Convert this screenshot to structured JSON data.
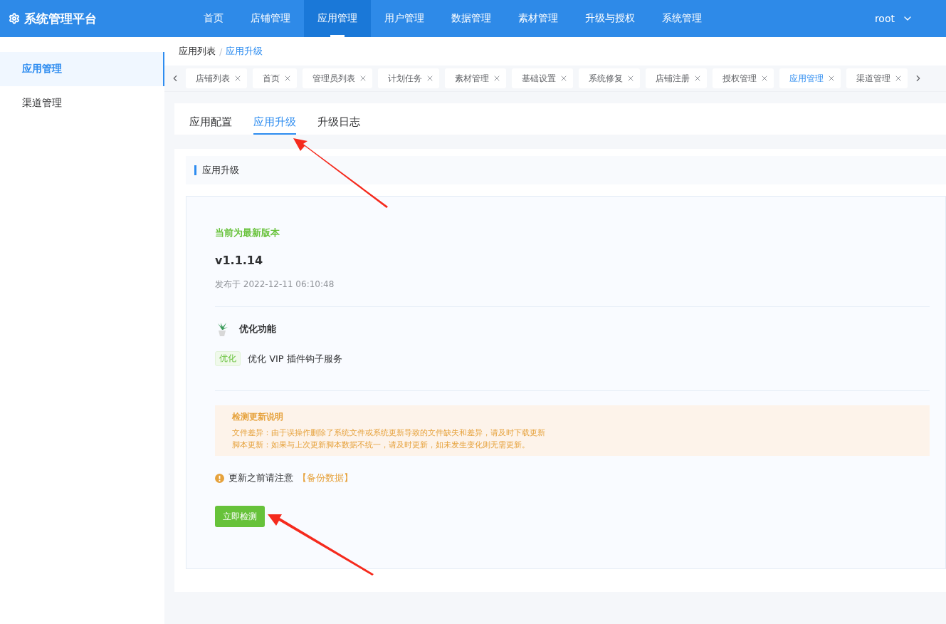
{
  "app": {
    "title": "系统管理平台"
  },
  "nav": [
    {
      "label": "首页",
      "selected": false
    },
    {
      "label": "店铺管理",
      "selected": false
    },
    {
      "label": "应用管理",
      "selected": true
    },
    {
      "label": "用户管理",
      "selected": false
    },
    {
      "label": "数据管理",
      "selected": false
    },
    {
      "label": "素材管理",
      "selected": false
    },
    {
      "label": "升级与授权",
      "selected": false
    },
    {
      "label": "系统管理",
      "selected": false
    }
  ],
  "user": {
    "name": "root"
  },
  "sidebar": [
    {
      "label": "应用管理",
      "selected": true
    },
    {
      "label": "渠道管理",
      "selected": false
    }
  ],
  "breadcrumb": [
    "应用列表",
    "应用升级"
  ],
  "breadcrumb_separator": "/",
  "open_tabs": [
    {
      "label": "店铺列表",
      "selected": false
    },
    {
      "label": "首页",
      "selected": false
    },
    {
      "label": "管理员列表",
      "selected": false
    },
    {
      "label": "计划任务",
      "selected": false
    },
    {
      "label": "素材管理",
      "selected": false
    },
    {
      "label": "基础设置",
      "selected": false
    },
    {
      "label": "系统修复",
      "selected": false
    },
    {
      "label": "店铺注册",
      "selected": false
    },
    {
      "label": "授权管理",
      "selected": false
    },
    {
      "label": "应用管理",
      "selected": true
    },
    {
      "label": "渠道管理",
      "selected": false
    }
  ],
  "page_tabs": [
    {
      "label": "应用配置",
      "selected": false
    },
    {
      "label": "应用升级",
      "selected": true
    },
    {
      "label": "升级日志",
      "selected": false
    }
  ],
  "section_title": "应用升级",
  "status": "当前为最新版本",
  "version": "v1.1.14",
  "release": "发布于 2022-12-11 06:10:48",
  "feature": {
    "title": "优化功能",
    "items": [
      {
        "tag": "优化",
        "text": "优化 VIP 插件钩子服务"
      }
    ]
  },
  "notice": {
    "title": "检测更新说明",
    "lines": [
      "文件差异：由于误操作删除了系统文件或系统更新导致的文件缺失和差异，请及时下载更新",
      "脚本更新：如果与上次更新脚本数据不统一，请及时更新，如未发生变化则无需更新。"
    ]
  },
  "warning": {
    "text": "更新之前请注意",
    "link": "【备份数据】"
  },
  "check_button": "立即检测"
}
